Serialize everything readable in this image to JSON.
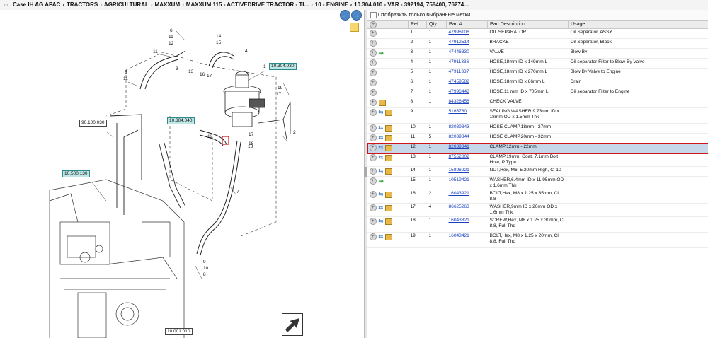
{
  "breadcrumb": {
    "home_icon": "home-icon",
    "items": [
      "Case IH AG APAC",
      "TRACTORS",
      "AGRICULTURAL",
      "MAXXUM",
      "MAXXUM 115 - ACTIVEDRIVE TRACTOR - TI...",
      "10 - ENGINE",
      "10.304.010 - VAR - 392194, 758400, 76274..."
    ]
  },
  "filter": {
    "label": "Отобразить только выбранные метки"
  },
  "table": {
    "columns": [
      "Ref",
      "Qty",
      "Part #",
      "Part Description",
      "Usage"
    ],
    "rows": [
      {
        "ref": "1",
        "qty": "1",
        "part": "47996106",
        "desc": "OIL SEPARATOR",
        "usage": "Oil Separator, ASSY",
        "icons": [
          "plus"
        ]
      },
      {
        "ref": "2",
        "qty": "1",
        "part": "47912514",
        "desc": "BRACKET",
        "usage": "Oil Separator, Black",
        "icons": [
          "plus"
        ]
      },
      {
        "ref": "3",
        "qty": "1",
        "part": "47446330",
        "desc": "VALVE",
        "usage": "Blow By",
        "icons": [
          "plus",
          "arrow"
        ]
      },
      {
        "ref": "4",
        "qty": "1",
        "part": "47911336",
        "desc": "HOSE,18mm ID x 149mm L",
        "usage": "Oil separator Filter to Blow By Valve",
        "icons": [
          "plus"
        ]
      },
      {
        "ref": "5",
        "qty": "1",
        "part": "47911337",
        "desc": "HOSE,18mm ID x 270mm L",
        "usage": "Blow By Valve to Engine",
        "icons": [
          "plus"
        ]
      },
      {
        "ref": "6",
        "qty": "1",
        "part": "47459582",
        "desc": "HOSE,18mm ID x 86mm L",
        "usage": "Drain",
        "icons": [
          "plus"
        ]
      },
      {
        "ref": "7",
        "qty": "1",
        "part": "47996448",
        "desc": "HOSE,11 mm ID x 705mm L",
        "usage": "Oil separator Filter to Engine",
        "icons": [
          "plus"
        ]
      },
      {
        "ref": "8",
        "qty": "1",
        "part": "84326458",
        "desc": "CHECK VALVE",
        "usage": "",
        "icons": [
          "plus",
          "box"
        ]
      },
      {
        "ref": "9",
        "qty": "1",
        "part": "5163780",
        "desc": "SEALING WASHER,9.73mm ID x 18mm OD x 1.5mm Thk",
        "usage": "",
        "icons": [
          "plus",
          "swap",
          "box"
        ]
      },
      {
        "ref": "10",
        "qty": "1",
        "part": "82039343",
        "desc": "HOSE CLAMP,18mm - 27mm",
        "usage": "",
        "icons": [
          "plus",
          "swap",
          "box"
        ]
      },
      {
        "ref": "11",
        "qty": "5",
        "part": "82039344",
        "desc": "HOSE CLAMP,20mm - 32mm",
        "usage": "",
        "icons": [
          "plus",
          "swap",
          "box"
        ]
      },
      {
        "ref": "12",
        "qty": "1",
        "part": "82039341",
        "desc": "CLAMP,12mm - 22mm",
        "usage": "",
        "icons": [
          "plus",
          "swap",
          "box"
        ]
      },
      {
        "ref": "13",
        "qty": "1",
        "part": "87552802",
        "desc": "CLAMP,19mm, Coat, 7.1mm Bolt Hole, P Type",
        "usage": "",
        "icons": [
          "plus",
          "swap",
          "box"
        ]
      },
      {
        "ref": "14",
        "qty": "1",
        "part": "15896221",
        "desc": "NUT,Hex, M6, 5.20mm High, Cl 10",
        "usage": "",
        "icons": [
          "plus",
          "swap",
          "box"
        ]
      },
      {
        "ref": "15",
        "qty": "1",
        "part": "10519421",
        "desc": "WASHER,6.4mm ID x 11.95mm OD x 1.6mm Thk",
        "usage": "",
        "icons": [
          "plus",
          "arrow"
        ]
      },
      {
        "ref": "16",
        "qty": "2",
        "part": "16043921",
        "desc": "BOLT,Hex, M8 x 1.25 x 35mm, Cl 8.8",
        "usage": "",
        "icons": [
          "plus",
          "swap",
          "box"
        ]
      },
      {
        "ref": "17",
        "qty": "4",
        "part": "86625263",
        "desc": "WASHER,9mm ID x 20mm OD x 1.6mm Thk",
        "usage": "",
        "icons": [
          "plus",
          "swap",
          "box"
        ]
      },
      {
        "ref": "18",
        "qty": "1",
        "part": "16043821",
        "desc": "SCREW,Hex, M8 x 1.25 x 30mm, Cl 8.8, Full Thd",
        "usage": "",
        "icons": [
          "plus",
          "swap",
          "box"
        ]
      },
      {
        "ref": "19",
        "qty": "1",
        "part": "16043421",
        "desc": "BOLT,Hex, M8 x 1.25 x 20mm, Cl 8.8, Full Thd",
        "usage": "",
        "icons": [
          "plus",
          "swap",
          "box"
        ]
      }
    ],
    "selected_ref": "12"
  },
  "diagram": {
    "callouts": {
      "c1": "10.304.030",
      "c2": "10.304.040",
      "c3": "90.100.030",
      "c4": "10.500.130",
      "c5": "10.001.010"
    },
    "numbers": [
      "6",
      "11",
      "12",
      "14",
      "15",
      "11",
      "1",
      "3",
      "4",
      "5",
      "11",
      "13",
      "16",
      "17",
      "18",
      "19",
      "17",
      "2",
      "7",
      "9",
      "10",
      "8",
      "12",
      "17",
      "18"
    ]
  },
  "colors": {
    "selected_row": "#c6d7ea",
    "selected_outline": "#d0141c",
    "link": "#1a3fbf",
    "callout_teal": "#bfe7e6"
  }
}
